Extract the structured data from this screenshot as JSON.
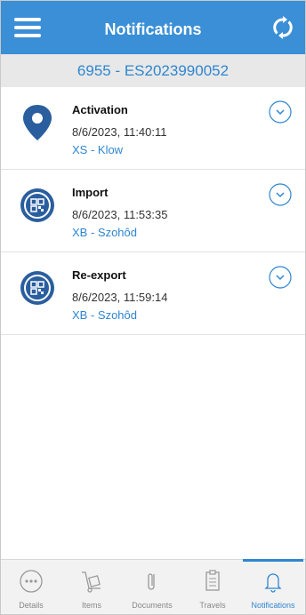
{
  "header": {
    "title": "Notifications"
  },
  "subheader": {
    "text": "6955 - ES2023990052"
  },
  "notifications": [
    {
      "title": "Activation",
      "timestamp": "8/6/2023, 11:40:11",
      "location": "XS - Klow",
      "icon": "location-pin-icon"
    },
    {
      "title": "Import",
      "timestamp": "8/6/2023, 11:53:35",
      "location": "XB - Szohôd",
      "icon": "qr-code-icon"
    },
    {
      "title": "Re-export",
      "timestamp": "8/6/2023, 11:59:14",
      "location": "XB - Szohôd",
      "icon": "qr-code-icon"
    }
  ],
  "tabs": [
    {
      "label": "Details",
      "icon": "more-dots-icon"
    },
    {
      "label": "Items",
      "icon": "hand-truck-icon"
    },
    {
      "label": "Documents",
      "icon": "paperclip-icon"
    },
    {
      "label": "Travels",
      "icon": "clipboard-icon"
    },
    {
      "label": "Notifications",
      "icon": "bell-icon",
      "active": true
    }
  ],
  "colors": {
    "primary": "#3a8fd6",
    "accent": "#2f86cf",
    "icon_dark": "#2a5e9e"
  }
}
